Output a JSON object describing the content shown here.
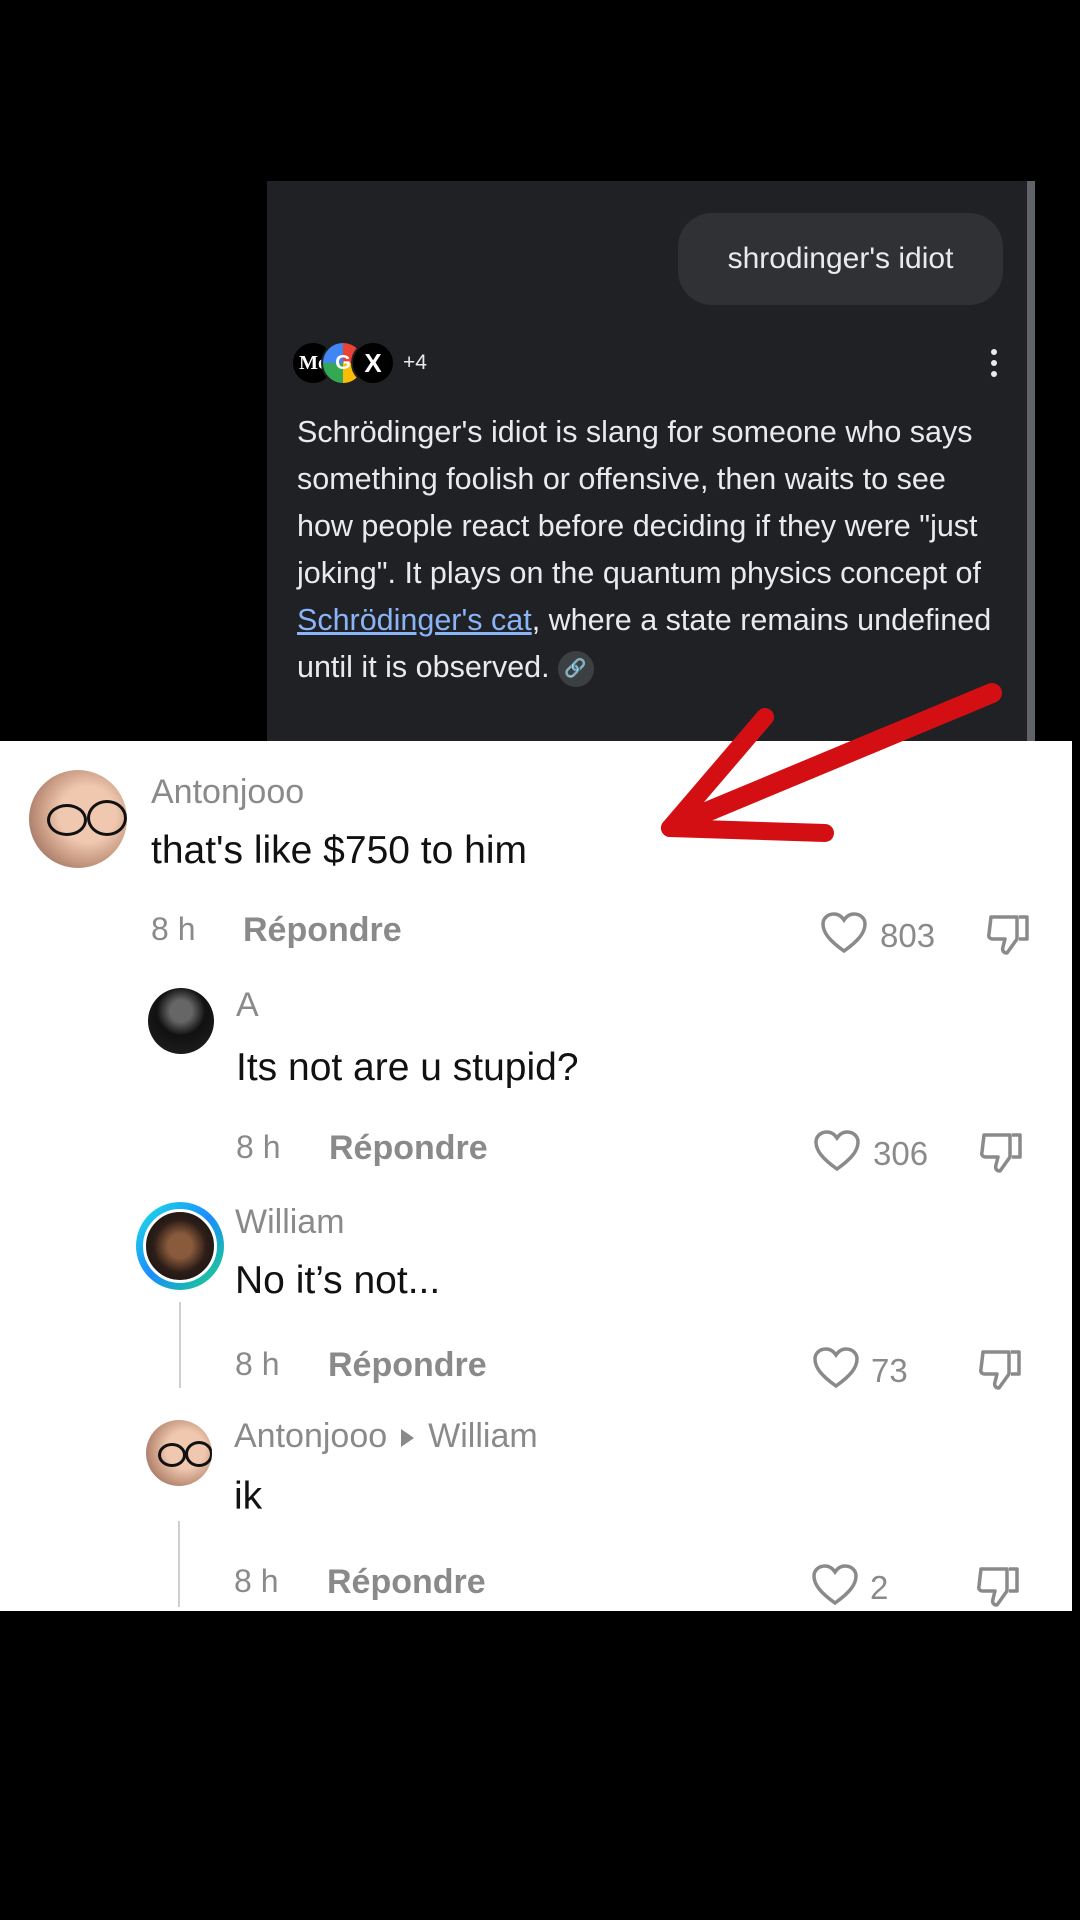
{
  "ai_overview": {
    "query": "shrodinger's idiot",
    "sources": [
      "Mc",
      "G",
      "X"
    ],
    "sources_more": "+4",
    "answer_before_link": "Schrödinger's idiot is slang for someone who says something foolish or offensive, then waits to see how people react before deciding if they were \"just joking\". It plays on the quantum physics concept of ",
    "answer_link": "Schrödinger's cat",
    "answer_after_link": ", where a state remains undefined until it is observed."
  },
  "comments": [
    {
      "username": "Antonjooo",
      "text": "that's like $750 to him",
      "time": "8 h",
      "reply": "Répondre",
      "likes": "803"
    },
    {
      "username": "A",
      "text": "Its not are u stupid?",
      "time": "8 h",
      "reply": "Répondre",
      "likes": "306"
    },
    {
      "username": "William",
      "text": "No it’s not...",
      "time": "8 h",
      "reply": "Répondre",
      "likes": "73"
    },
    {
      "username": "Antonjooo",
      "reply_to": "William",
      "text": "ik",
      "time": "8 h",
      "reply": "Répondre",
      "likes": "2"
    }
  ],
  "colors": {
    "annotation_arrow": "#d40f14",
    "link": "#8ab4f8",
    "panel_bg": "#202124"
  }
}
